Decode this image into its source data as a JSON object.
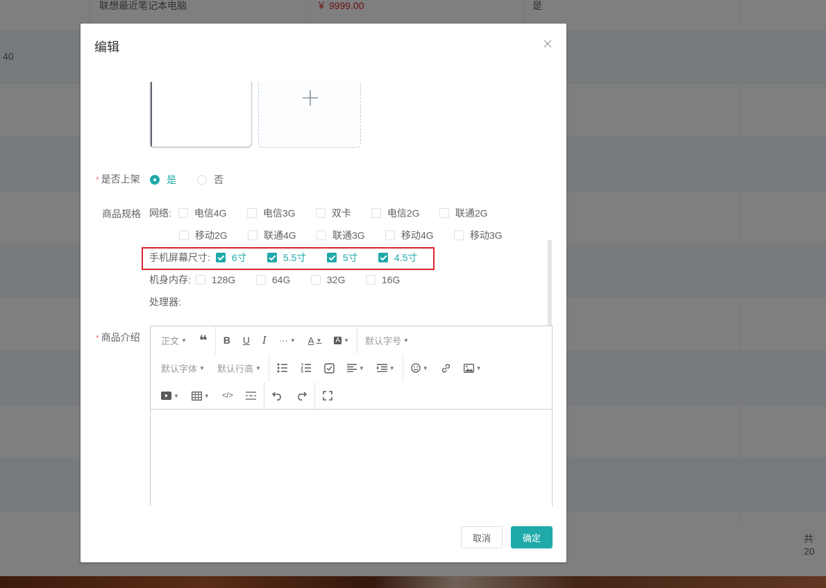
{
  "background": {
    "first_row": {
      "name": "联想最近笔记本电脑",
      "price": "￥ 9999.00",
      "on_sale": "是"
    },
    "second_row_id": "40",
    "pagination_total": "共 20"
  },
  "dialog": {
    "title": "编辑",
    "close_icon": "close-icon",
    "on_shelf": {
      "label": "是否上架",
      "options": [
        "是",
        "否"
      ],
      "selected": "是"
    },
    "spec": {
      "label": "商品规格",
      "network": {
        "name": "网络:",
        "row1": [
          "电信4G",
          "电信3G",
          "双卡",
          "电信2G",
          "联通2G"
        ],
        "row2": [
          "移动2G",
          "联通4G",
          "联通3G",
          "移动4G",
          "移动3G"
        ]
      },
      "screen": {
        "name": "手机屏幕尺寸:",
        "options": [
          "6寸",
          "5.5寸",
          "5寸",
          "4.5寸"
        ]
      },
      "memory": {
        "name": "机身内存:",
        "options": [
          "128G",
          "64G",
          "32G",
          "16G"
        ]
      },
      "cpu": {
        "name": "处理器:"
      }
    },
    "intro": {
      "label": "商品介绍",
      "toolbar": {
        "heading": "正文",
        "font_size": "默认字号",
        "font_family": "默认字体",
        "line_height": "默认行高"
      }
    },
    "buttons": {
      "cancel": "取消",
      "confirm": "确定"
    }
  },
  "colors": {
    "accent": "#1fa9a9",
    "required": "#f56c6c",
    "highlight": "#d9252a",
    "price": "#d9252a"
  }
}
